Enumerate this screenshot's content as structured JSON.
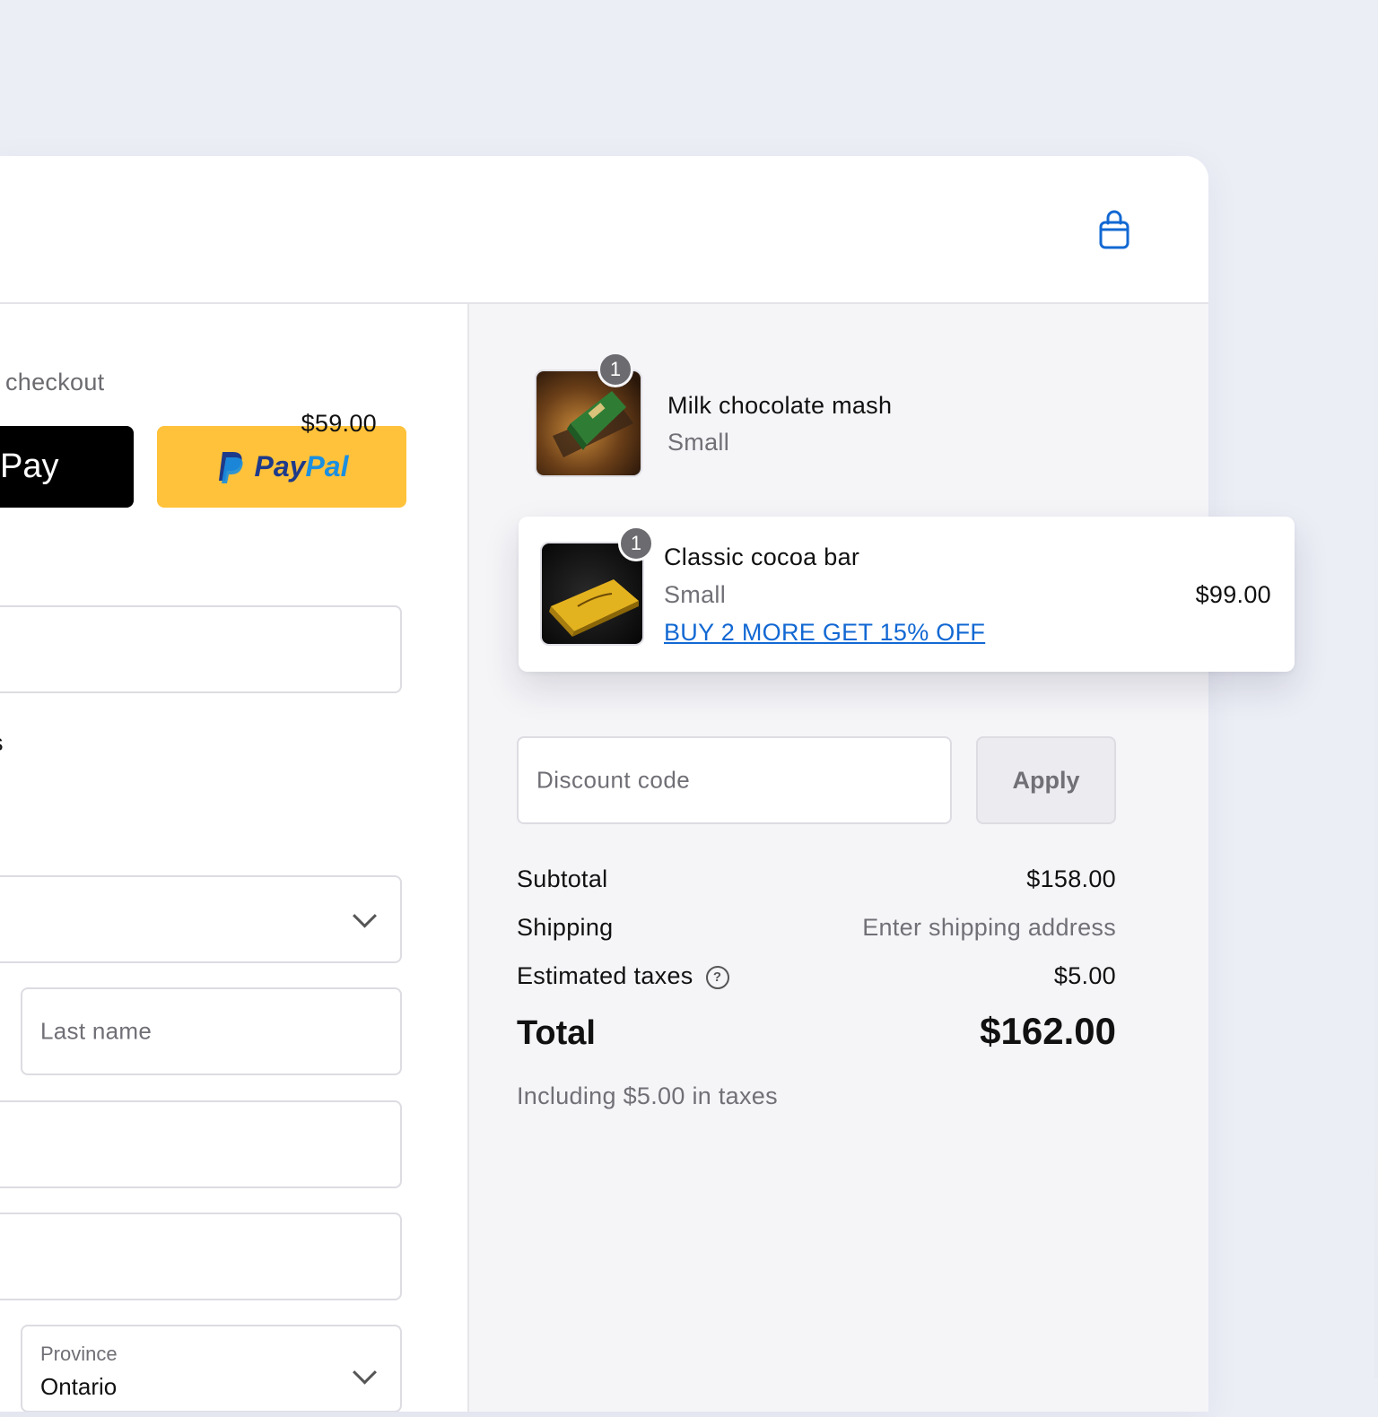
{
  "express": {
    "label": "checkout",
    "applepay_label": "Pay",
    "paypal_pay": "Pay",
    "paypal_pal": "Pal"
  },
  "form": {
    "cut_text": "s",
    "last_name_placeholder": "Last name",
    "province_label": "Province",
    "province_value": "Ontario"
  },
  "cart": {
    "items": [
      {
        "name": "Milk chocolate mash",
        "variant": "Small",
        "price": "$59.00",
        "quantity": "1"
      },
      {
        "name": "Classic cocoa bar",
        "variant": "Small",
        "price": "$99.00",
        "quantity": "1",
        "promo": "BUY 2 MORE GET 15% OFF"
      }
    ]
  },
  "discount": {
    "placeholder": "Discount code",
    "apply_label": "Apply"
  },
  "summary": {
    "subtotal_label": "Subtotal",
    "subtotal_value": "$158.00",
    "shipping_label": "Shipping",
    "shipping_value": "Enter shipping address",
    "taxes_label": "Estimated taxes",
    "taxes_value": "$5.00",
    "total_label": "Total",
    "total_value": "$162.00",
    "tax_note": "Including $5.00 in taxes"
  },
  "colors": {
    "accent": "#1268d3",
    "paypal_yellow": "#ffc23a",
    "badge": "#6b6b70"
  }
}
